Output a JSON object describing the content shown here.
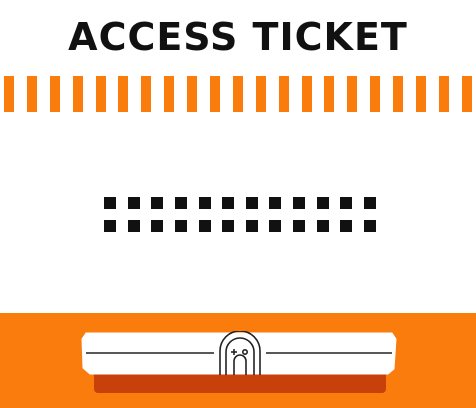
{
  "ticket": {
    "title": "ACCESS TICKET",
    "stripe_count": 21,
    "code_rows": [
      12,
      12
    ],
    "emblem_icon": "arch-doorway-icon"
  },
  "colors": {
    "accent": "#f97c0c",
    "accent_dark": "#c8400a",
    "ink": "#111111",
    "paper": "#ffffff"
  }
}
